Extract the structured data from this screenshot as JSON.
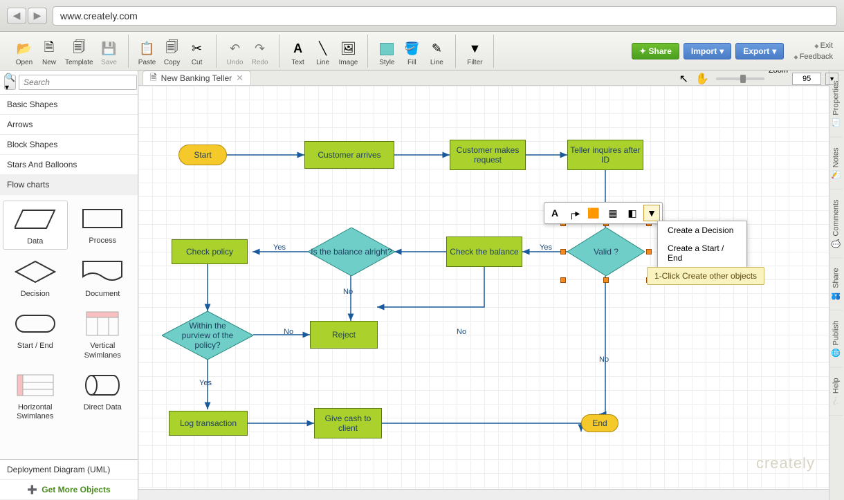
{
  "browser": {
    "url": "www.creately.com"
  },
  "toolbar": {
    "open": "Open",
    "new": "New",
    "template": "Template",
    "save": "Save",
    "paste": "Paste",
    "copy": "Copy",
    "cut": "Cut",
    "undo": "Undo",
    "redo": "Redo",
    "text": "Text",
    "line": "Line",
    "image": "Image",
    "style": "Style",
    "fill": "Fill",
    "line2": "Line",
    "filter": "Filter",
    "share": "Share",
    "import": "Import",
    "export": "Export",
    "exit": "Exit",
    "feedback": "Feedback"
  },
  "search": {
    "placeholder": "Search"
  },
  "categories": [
    "Basic Shapes",
    "Arrows",
    "Block Shapes",
    "Stars And Balloons",
    "Flow charts"
  ],
  "shapes": [
    {
      "label": "Data"
    },
    {
      "label": "Process"
    },
    {
      "label": "Decision"
    },
    {
      "label": "Document"
    },
    {
      "label": "Start / End"
    },
    {
      "label": "Vertical\nSwimlanes"
    },
    {
      "label": "Horizontal\nSwimlanes"
    },
    {
      "label": "Direct Data"
    }
  ],
  "footer": {
    "deployment": "Deployment Diagram (UML)",
    "getmore": "Get More Objects"
  },
  "document": {
    "tab": "New Banking Teller"
  },
  "zoom": {
    "label": "Zoom",
    "value": "95"
  },
  "contextMenu": {
    "decision": "Create a Decision",
    "startend": "Create a Start / End"
  },
  "tooltip": "1-Click Create other objects",
  "rtabs": [
    "Properties",
    "Notes",
    "Comments",
    "Share",
    "Publish",
    "Help"
  ],
  "logo": "creately",
  "flow": {
    "start": "Start",
    "custArrives": "Customer arrives",
    "custReq": "Customer makes request",
    "tellerId": "Teller inquires after ID",
    "valid": "Valid ?",
    "checkBal": "Check the balance",
    "balOk": "Is the balance alright?",
    "checkPol": "Check policy",
    "withinPol": "Within the purview of the policy?",
    "reject": "Reject",
    "logTx": "Log transaction",
    "giveCash": "Give cash to client",
    "end": "End",
    "yes": "Yes",
    "no": "No"
  }
}
